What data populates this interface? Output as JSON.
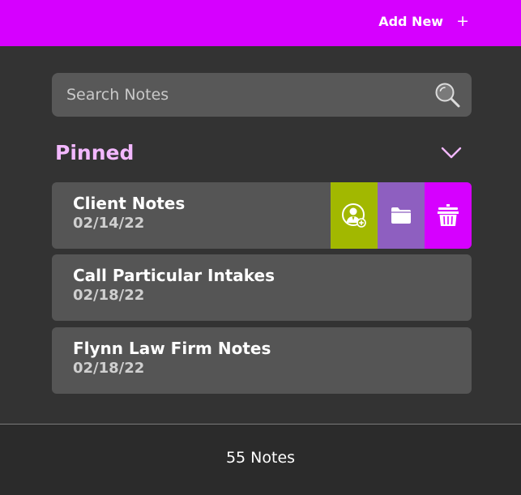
{
  "header": {
    "add_new_label": "Add New",
    "plus_icon": "plus-icon",
    "bg_color": "#d600ff"
  },
  "search": {
    "placeholder": "Search Notes",
    "value": "",
    "icon": "search-icon"
  },
  "pinned": {
    "title": "Pinned",
    "toggle_icon": "chevron-down-icon",
    "notes": [
      {
        "title": "Client Notes",
        "date": "02/14/22"
      },
      {
        "title": "Call Particular Intakes",
        "date": "02/18/22"
      },
      {
        "title": "Flynn Law Firm Notes",
        "date": "02/18/22"
      }
    ],
    "swipe_actions": [
      {
        "name": "assign-client",
        "icon": "user-add-icon",
        "color": "#a2b800"
      },
      {
        "name": "move-to-folder",
        "icon": "folder-icon",
        "color": "#8e5fc0"
      },
      {
        "name": "delete",
        "icon": "trash-icon",
        "color": "#d600ff"
      }
    ]
  },
  "footer": {
    "count_label": "55 Notes"
  }
}
